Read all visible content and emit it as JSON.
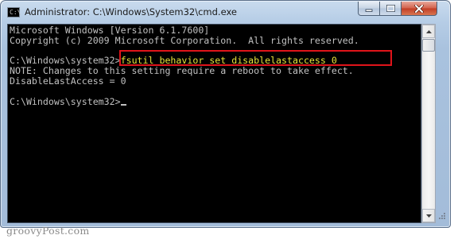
{
  "window": {
    "title": "Administrator: C:\\Windows\\System32\\cmd.exe",
    "icon": "cmd-icon",
    "icon_glyph": "C:\\"
  },
  "controls": {
    "minimize_icon": "minimize-icon",
    "maximize_icon": "maximize-icon",
    "close_icon": "close-icon"
  },
  "console": {
    "lines": [
      {
        "text": "Microsoft Windows [Version 6.1.7600]"
      },
      {
        "text": "Copyright (c) 2009 Microsoft Corporation.  All rights reserved."
      },
      {
        "text": ""
      },
      {
        "prompt": "C:\\Windows\\system32>",
        "command": "fsutil behavior set disablelastaccess 0"
      },
      {
        "text": "NOTE: Changes to this setting require a reboot to take effect."
      },
      {
        "text": "DisableLastAccess = 0"
      },
      {
        "text": ""
      },
      {
        "prompt": "C:\\Windows\\system32>",
        "cursor": true
      }
    ],
    "text_color": "#c0c0c0",
    "command_color": "#e8e23a",
    "background": "#000000",
    "highlight_color": "#e0141a"
  },
  "watermark": {
    "text": "groovyPost.com"
  }
}
